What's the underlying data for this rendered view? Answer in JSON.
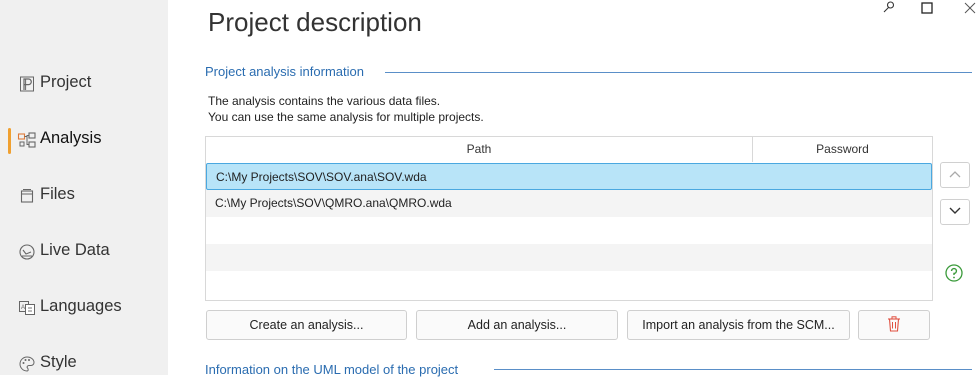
{
  "window": {
    "pin_icon": "pin-icon",
    "maximize_icon": "maximize-icon",
    "close_icon": "close-icon"
  },
  "page_title": "Project description",
  "sidebar": {
    "items": [
      {
        "label": "Project",
        "icon": "project-icon"
      },
      {
        "label": "Analysis",
        "icon": "analysis-icon",
        "active": true
      },
      {
        "label": "Files",
        "icon": "files-icon"
      },
      {
        "label": "Live Data",
        "icon": "live-data-icon"
      },
      {
        "label": "Languages",
        "icon": "languages-icon"
      },
      {
        "label": "Style",
        "icon": "style-icon"
      }
    ]
  },
  "section_analysis": {
    "title": "Project analysis information",
    "desc_line1": "The analysis contains the various data files.",
    "desc_line2": "You can use the same analysis for multiple projects.",
    "table": {
      "columns": [
        "Path",
        "Password"
      ],
      "rows": [
        {
          "path": "C:\\My Projects\\SOV\\SOV.ana\\SOV.wda",
          "password": "",
          "selected": true
        },
        {
          "path": "C:\\My Projects\\SOV\\QMRO.ana\\QMRO.wda",
          "password": ""
        }
      ]
    },
    "buttons": {
      "create": "Create an analysis...",
      "add": "Add an analysis...",
      "import": "Import an analysis from the SCM...",
      "delete_icon": "trash-icon"
    },
    "side_buttons": {
      "up_icon": "chevron-up-icon",
      "down_icon": "chevron-down-icon",
      "help_icon": "help-icon"
    }
  },
  "section_uml": {
    "title": "Information on the UML model of the project"
  },
  "colors": {
    "accent": "#f0a030",
    "section_blue": "#2a6cb0",
    "selection": "#b8e4f8",
    "selection_border": "#4aa8e0",
    "delete_red": "#e05040",
    "help_green": "#3a9a3a"
  }
}
